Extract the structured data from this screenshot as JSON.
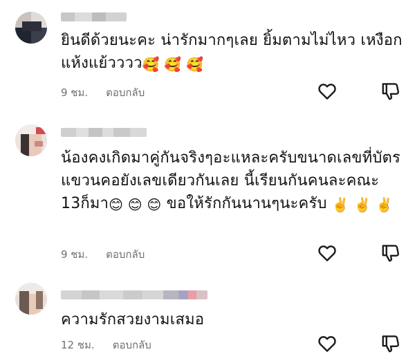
{
  "comments": [
    {
      "text": "ยินดีด้วยนะคะ น่ารักมากๆเลย ยิ้มตามไม่ไหว เหงือกแห้งแย้วววว",
      "emojis": "🥰 🥰 🥰",
      "time": "9 ชม.",
      "reply_label": "ตอบกลับ",
      "like_icon": "heart-outline",
      "dislike_icon": "thumbs-down-outline"
    },
    {
      "text": "น้องคงเกิดมาคู่กันจริงๆอะแหละครับขนาดเลขที่บัตรแขวนคอยังเลขเดียวกันเลย นี้เรียนกันคนละคณะ 13ก็มา",
      "emojis_a": "😊 😊 😊",
      "text_b": "ขอให้รักกันนานๆนะครับ",
      "emojis_b": "✌️ ✌️ ✌️",
      "time": "9 ชม.",
      "reply_label": "ตอบกลับ",
      "like_icon": "heart-outline",
      "dislike_icon": "thumbs-down-outline"
    },
    {
      "text": "ความรักสวยงามเสมอ",
      "time": "12 ชม.",
      "reply_label": "ตอบกลับ",
      "like_icon": "heart-outline",
      "dislike_icon": "thumbs-down-outline"
    }
  ]
}
